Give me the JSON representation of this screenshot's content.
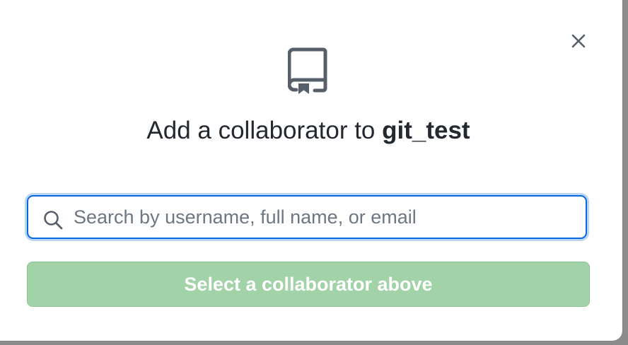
{
  "dialog": {
    "title_prefix": "Add a collaborator to ",
    "repo_name": "git_test",
    "close_icon": "close-icon",
    "header_icon": "repo-icon"
  },
  "search": {
    "icon": "search-icon",
    "placeholder": "Search by username, full name, or email",
    "value": "",
    "focus_color": "#0969da"
  },
  "submit": {
    "label": "Select a collaborator above",
    "disabled": true,
    "color": "#a2d2a8"
  }
}
